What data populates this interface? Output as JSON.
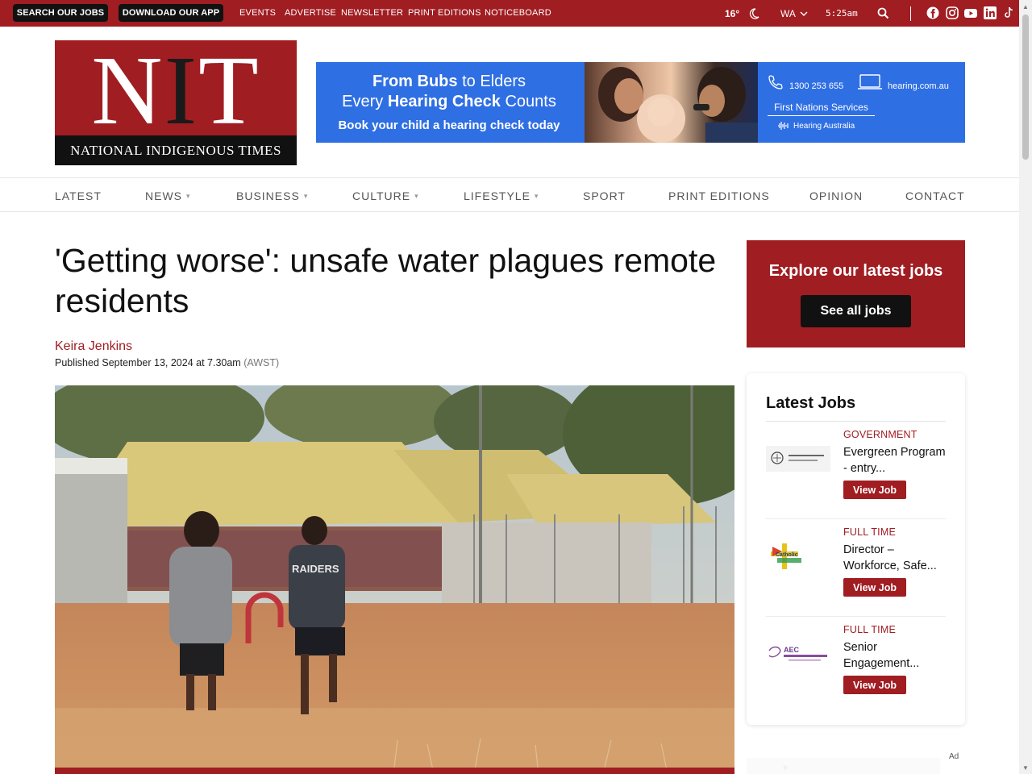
{
  "topbar": {
    "search_jobs_label": "SEARCH OUR JOBS",
    "download_app_label": "DOWNLOAD OUR APP",
    "links": [
      "EVENTS",
      "ADVERTISE",
      "NEWSLETTER",
      "PRINT EDITIONS",
      "NOTICEBOARD"
    ],
    "temperature": "16°",
    "region": "WA",
    "time": "5:25am",
    "social_icons": [
      "facebook-icon",
      "instagram-icon",
      "youtube-icon",
      "linkedin-icon",
      "tiktok-icon"
    ]
  },
  "logo": {
    "letter_n": "N",
    "letter_i": "I",
    "letter_t": "T",
    "name": "NATIONAL INDIGENOUS TIMES"
  },
  "banner": {
    "line1_bold": "From Bubs",
    "line1_rest": " to Elders",
    "line2_start": "Every ",
    "line2_bold": "Hearing Check",
    "line2_end": " Counts",
    "line3": "Book your child a hearing check today",
    "phone": "1300 253 655",
    "website": "hearing.com.au",
    "services": "First Nations Services",
    "brand": "Hearing Australia"
  },
  "nav": {
    "items": [
      {
        "label": "LATEST"
      },
      {
        "label": "NEWS"
      },
      {
        "label": "BUSINESS"
      },
      {
        "label": "CULTURE"
      },
      {
        "label": "LIFESTYLE"
      },
      {
        "label": "SPORT"
      },
      {
        "label": "PRINT EDITIONS"
      },
      {
        "label": "OPINION"
      },
      {
        "label": "CONTACT"
      }
    ]
  },
  "article": {
    "headline": "'Getting worse': unsafe water plagues remote residents",
    "author": "Keira Jenkins",
    "published": "Published September 13, 2024 at 7.30am",
    "timezone": "(AWST)",
    "shirt_text": "RAIDERS"
  },
  "sidebar": {
    "promo_title": "Explore our latest jobs",
    "promo_button": "See all jobs",
    "jobs_heading": "Latest Jobs",
    "jobs": [
      {
        "type": "GOVERNMENT",
        "title": "Evergreen Program - entry...",
        "button": "View Job",
        "logo_text": "Australian Government"
      },
      {
        "type": "FULL TIME",
        "title": "Director – Workforce, Safe...",
        "button": "View Job",
        "logo_text": "Catholic Education"
      },
      {
        "type": "FULL TIME",
        "title": "Senior Engagement...",
        "button": "View Job",
        "logo_text": "AEC"
      }
    ],
    "ad_label": "Ad"
  },
  "colors": {
    "brand_red": "#a01d22",
    "banner_blue": "#2f6fe4",
    "dark": "#111111"
  }
}
